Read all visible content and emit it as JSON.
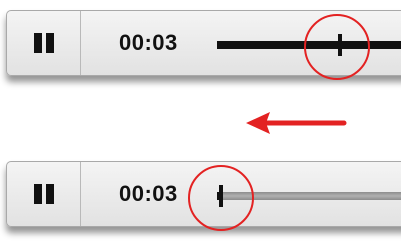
{
  "player_before": {
    "time": "00:03",
    "progress_fraction": 0.6,
    "pause_icon": "pause-icon"
  },
  "player_after": {
    "time": "00:03",
    "progress_fraction": 0.02,
    "pause_icon": "pause-icon"
  },
  "annotations": {
    "arrow_direction": "left",
    "arrow_color": "#e32222",
    "circle_color": "#e32222"
  }
}
